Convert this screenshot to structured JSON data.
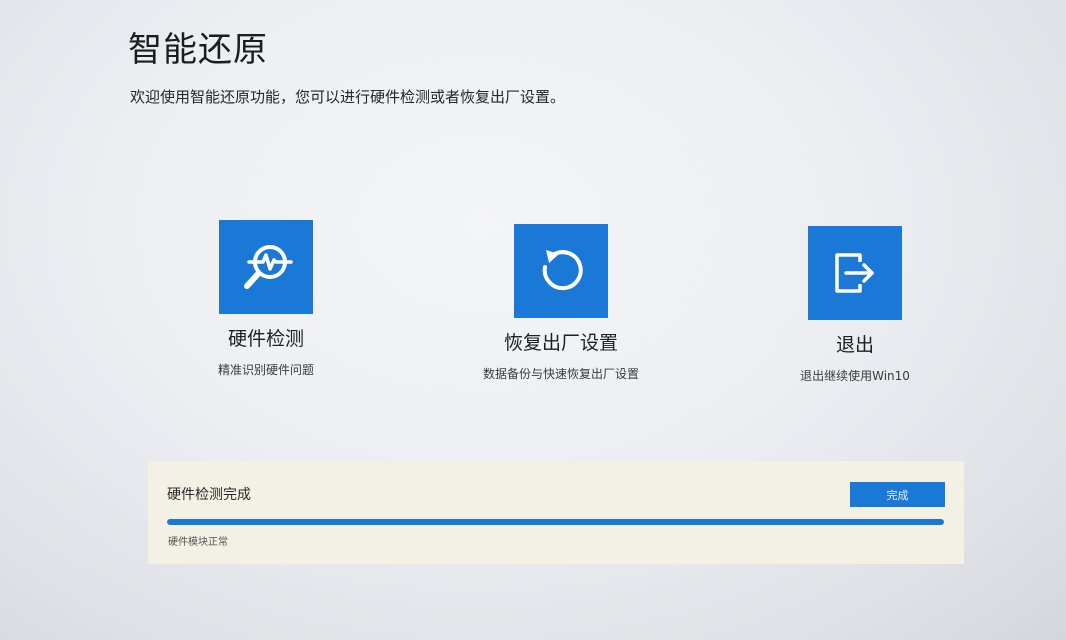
{
  "header": {
    "title": "智能还原",
    "subtitle": "欢迎使用智能还原功能，您可以进行硬件检测或者恢复出厂设置。"
  },
  "options": [
    {
      "id": "hardware",
      "icon": "hardware-scan-icon",
      "label": "硬件检测",
      "description": "精准识别硬件问题"
    },
    {
      "id": "restore",
      "icon": "restore-icon",
      "label": "恢复出厂设置",
      "description": "数据备份与快速恢复出厂设置"
    },
    {
      "id": "exit",
      "icon": "exit-icon",
      "label": "退出",
      "description": "退出继续使用Win10"
    }
  ],
  "status": {
    "title": "硬件检测完成",
    "button_label": "完成",
    "progress": 1.0,
    "detail": "硬件模块正常"
  },
  "colors": {
    "accent": "#1a78d6",
    "panel_background": "#f3f1e6"
  }
}
